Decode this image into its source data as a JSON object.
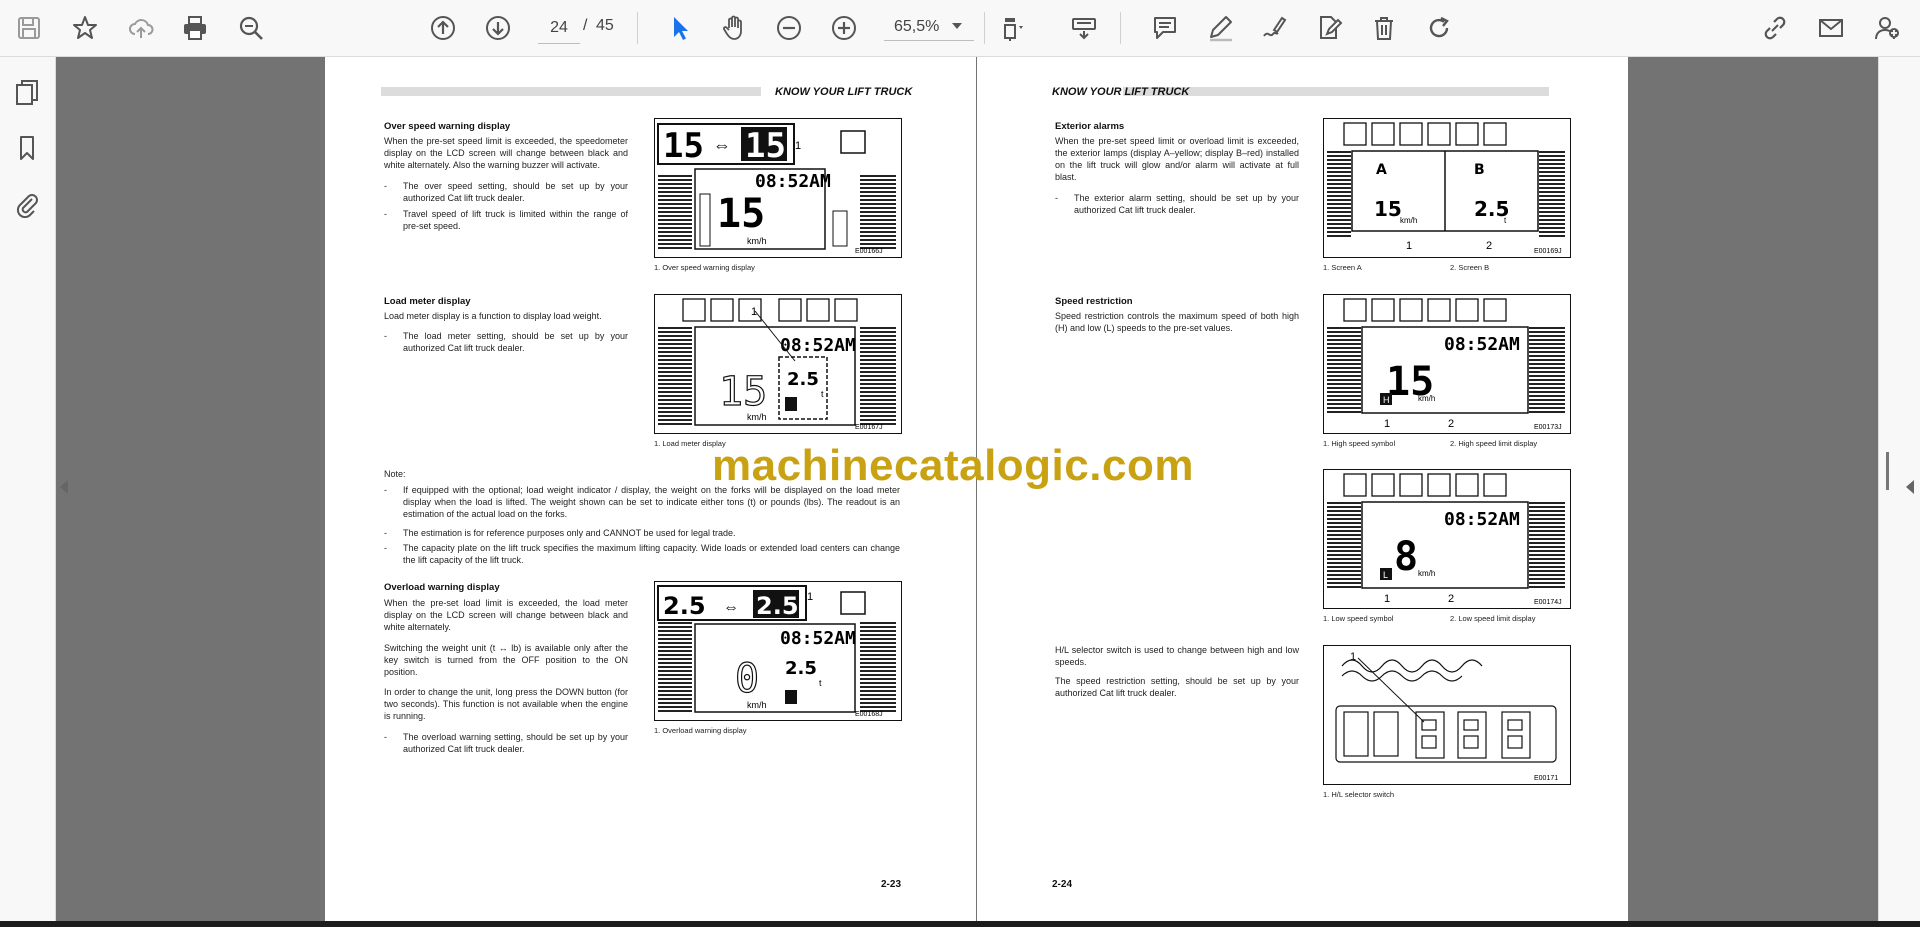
{
  "toolbar": {
    "page_current": "24",
    "page_sep": "/",
    "page_total": "45",
    "zoom": "65,5%",
    "icons_left": [
      "save-icon",
      "bookmark-star-icon",
      "upload-cloud-icon",
      "print-icon",
      "zoom-out-search-icon"
    ],
    "icons_nav": [
      "page-up-icon",
      "page-down-icon"
    ],
    "icons_tools": [
      "select-cursor-icon",
      "hand-icon",
      "zoom-minus-icon",
      "zoom-plus-icon"
    ],
    "icons_right": [
      "fit-page-icon",
      "keyboard-icon",
      "comment-icon",
      "pen-icon",
      "sign-icon",
      "edit-document-icon",
      "delete-icon",
      "rotate-icon",
      "link-icon",
      "mail-icon",
      "add-user-icon"
    ]
  },
  "side_icons": [
    "pages-icon",
    "bookmark-icon",
    "attachment-icon"
  ],
  "watermark": "machinecatalogic.com",
  "left_page": {
    "header": "KNOW YOUR LIFT TRUCK",
    "page_number": "2-23",
    "overspeed": {
      "title": "Over speed warning display",
      "body": "When the pre-set speed limit is exceeded, the speedometer display on the LCD screen will change between black and white alternately. Also the warning buzzer will activate.",
      "bullets": [
        "The over speed setting, should be set up by your authorized Cat lift truck dealer.",
        "Travel speed of lift truck is limited within the range of pre-set speed."
      ],
      "caption": "1. Over speed warning display",
      "fig_code": "E00166J",
      "fig_num": "1",
      "fig_big": "15",
      "fig_time": "08:52AM",
      "fig_speed": "15",
      "fig_unit": "km/h"
    },
    "loadmeter": {
      "title": "Load meter display",
      "body": "Load meter display is a function to display load weight.",
      "bullets": [
        "The load meter setting, should be set up by your authorized Cat lift truck dealer."
      ],
      "caption": "1. Load meter display",
      "fig_code": "E00167J",
      "fig_num": "1",
      "fig_time": "08:52AM",
      "fig_speed": "15",
      "fig_load": "2.5",
      "fig_t": "t",
      "fig_unit": "km/h"
    },
    "note": {
      "label": "Note:",
      "bullets": [
        "If equipped with the optional; load weight indicator / display, the weight on the forks will be displayed on the load meter display when the load is lifted. The weight shown can be set to indicate either tons (t) or pounds (lbs). The readout is an estimation of the actual load on the forks.",
        "The estimation is for reference purposes only and CANNOT be used for legal trade.",
        "The capacity plate on the lift truck specifies the maximum lifting capacity. Wide loads or extended load centers can change the lift capacity of the lift truck."
      ]
    },
    "overload": {
      "title": "Overload warning display",
      "paras": [
        "When the pre-set load limit is exceeded, the load meter display on the LCD screen will change between black and white alternately.",
        "Switching the weight unit (t ↔ lb) is available only after the key switch is turned from the OFF position to the ON position.",
        "In order to change the unit, long press the DOWN button (for two seconds). This function is not available when the engine is running."
      ],
      "bullets": [
        "The overload warning setting, should be set up by your authorized Cat lift truck dealer."
      ],
      "caption": "1. Overload warning display",
      "fig_code": "E00168J",
      "fig_num": "1",
      "fig_big": "2.5",
      "fig_time": "08:52AM",
      "fig_speed": "0",
      "fig_load": "2.5",
      "fig_t": "t",
      "fig_unit": "km/h"
    }
  },
  "right_page": {
    "header": "KNOW YOUR LIFT TRUCK",
    "page_number": "2-24",
    "exterior": {
      "title": "Exterior alarms",
      "body": "When the pre-set speed limit or overload limit is exceeded, the exterior lamps (display A–yellow; display B–red) installed on the lift truck will glow and/or alarm will activate at full blast.",
      "bullets": [
        "The exterior alarm setting, should be set up by your authorized Cat lift truck dealer."
      ],
      "caption_a": "1. Screen A",
      "caption_b": "2. Screen B",
      "fig_code": "E00169J",
      "fig_label_a": "A",
      "fig_label_b": "B",
      "fig_speed": "15",
      "fig_unit": "km/h",
      "fig_load": "2.5",
      "fig_t": "t",
      "fig_n1": "1",
      "fig_n2": "2"
    },
    "speed": {
      "title": "Speed restriction",
      "body": "Speed restriction controls the maximum speed of both high (H) and low (L) speeds to the pre-set values.",
      "caption_a": "1. High speed symbol",
      "caption_b": "2. High speed limit display",
      "fig_code": "E00173J",
      "fig_time": "08:52AM",
      "fig_speed": "15",
      "fig_unit": "km/h",
      "fig_sym": "H",
      "fig_n1": "1",
      "fig_n2": "2"
    },
    "lowspeed": {
      "caption_a": "1. Low speed symbol",
      "caption_b": "2. Low speed limit display",
      "fig_code": "E00174J",
      "fig_time": "08:52AM",
      "fig_speed": "8",
      "fig_unit": "km/h",
      "fig_sym": "L",
      "fig_n1": "1",
      "fig_n2": "2"
    },
    "selector": {
      "paras": [
        "H/L selector switch is used to change between high and low speeds.",
        "The speed restriction setting, should be set up by your authorized Cat lift truck dealer."
      ],
      "caption": "1. H/L selector switch",
      "fig_code": "E00171",
      "fig_num": "1"
    }
  }
}
